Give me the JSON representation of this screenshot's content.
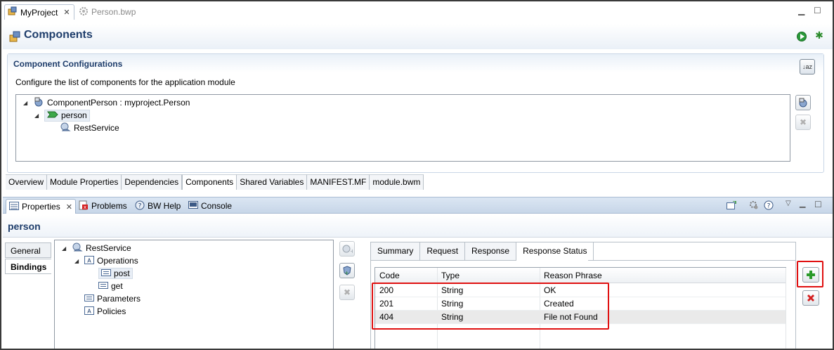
{
  "editor_tabs": [
    {
      "label": "MyProject",
      "icon": "project-icon"
    },
    {
      "label": "Person.bwp",
      "icon": "process-gear-icon"
    }
  ],
  "header": {
    "title": "Components"
  },
  "config": {
    "title": "Component Configurations",
    "description": "Configure the list of components for the application module",
    "tree": [
      {
        "label": "ComponentPerson : myproject.Person",
        "icon": "component-icon"
      },
      {
        "label": "person",
        "icon": "service-arrow-icon"
      },
      {
        "label": "RestService",
        "icon": "rest-service-icon"
      }
    ]
  },
  "editor_bottom_tabs": [
    "Overview",
    "Module Properties",
    "Dependencies",
    "Components",
    "Shared Variables",
    "MANIFEST.MF",
    "module.bwm"
  ],
  "views": [
    {
      "label": "Properties",
      "icon": "properties-icon"
    },
    {
      "label": "Problems",
      "icon": "problems-icon"
    },
    {
      "label": "BW Help",
      "icon": "help-icon"
    },
    {
      "label": "Console",
      "icon": "console-icon"
    }
  ],
  "properties": {
    "title": "person",
    "side_tabs": [
      "General",
      "Bindings"
    ],
    "binding_tree": [
      {
        "label": "RestService",
        "icon": "rest-service-icon"
      },
      {
        "label": "Operations",
        "icon": "operations-icon"
      },
      {
        "label": "post",
        "icon": "operation-icon"
      },
      {
        "label": "get",
        "icon": "operation-icon"
      },
      {
        "label": "Parameters",
        "icon": "parameters-icon"
      },
      {
        "label": "Policies",
        "icon": "policies-icon"
      }
    ],
    "right_tabs": [
      "Summary",
      "Request",
      "Response",
      "Response Status"
    ],
    "table": {
      "columns": [
        "Code",
        "Type",
        "Reason Phrase"
      ],
      "rows": [
        [
          "200",
          "String",
          "OK"
        ],
        [
          "201",
          "String",
          "Created"
        ],
        [
          "404",
          "String",
          "File not Found"
        ]
      ]
    }
  },
  "colors": {
    "highlight": "#e01010",
    "title_blue": "#1e3d6b",
    "add_green": "#2a9a2a",
    "remove_red": "#d42020"
  }
}
